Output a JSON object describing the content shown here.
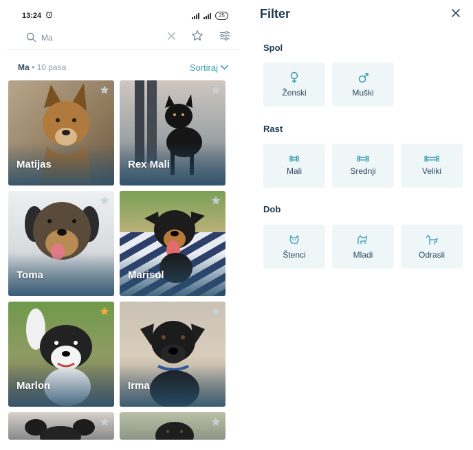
{
  "status": {
    "time": "13:24",
    "battery": "25"
  },
  "search": {
    "value": "Ma"
  },
  "results": {
    "query": "Ma",
    "count_text": "10 pasa",
    "separator": "•",
    "sort_label": "Sortiraj"
  },
  "dogs": [
    {
      "name": "Matijas",
      "favorite": false
    },
    {
      "name": "Rex Mali",
      "favorite": false
    },
    {
      "name": "Toma",
      "favorite": false
    },
    {
      "name": "Marisol",
      "favorite": false
    },
    {
      "name": "Marlon",
      "favorite": true
    },
    {
      "name": "Irma",
      "favorite": false
    }
  ],
  "filter": {
    "title": "Filter",
    "sections": [
      {
        "title": "Spol",
        "options": [
          {
            "label": "Ženski",
            "icon": "female-icon"
          },
          {
            "label": "Muški",
            "icon": "male-icon"
          }
        ]
      },
      {
        "title": "Rast",
        "options": [
          {
            "label": "Mali",
            "icon": "bone-small-icon"
          },
          {
            "label": "Srednji",
            "icon": "bone-medium-icon"
          },
          {
            "label": "Veliki",
            "icon": "bone-large-icon"
          }
        ]
      },
      {
        "title": "Dob",
        "options": [
          {
            "label": "Štenci",
            "icon": "puppy-icon"
          },
          {
            "label": "Mladi",
            "icon": "young-dog-icon"
          },
          {
            "label": "Odrasli",
            "icon": "adult-dog-icon"
          }
        ]
      }
    ]
  },
  "colors": {
    "accent": "#3a9bb2",
    "star_active": "#f2a93b",
    "star_inactive": "#c9d3da",
    "option_bg": "#eef6f8"
  }
}
